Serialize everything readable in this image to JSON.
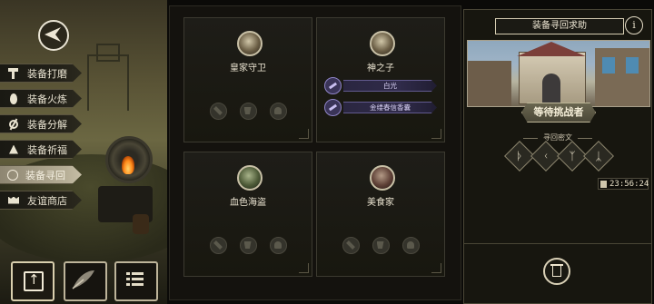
{
  "menu": {
    "items": [
      {
        "label": "装备打磨",
        "icon": "hammer-icon"
      },
      {
        "label": "装备火炼",
        "icon": "flame-icon"
      },
      {
        "label": "装备分解",
        "icon": "split-icon"
      },
      {
        "label": "装备祈福",
        "icon": "pray-icon"
      },
      {
        "label": "装备寻回",
        "icon": "search-icon",
        "active": true
      },
      {
        "label": "友谊商店",
        "icon": "shop-icon"
      }
    ]
  },
  "players": [
    {
      "name": "皇家守卫",
      "avatar": "knight-avatar"
    },
    {
      "name": "神之子",
      "avatar": "helmet-avatar",
      "items": [
        "白光",
        "金缕春信香囊"
      ]
    },
    {
      "name": "血色海盗",
      "avatar": "pirate-avatar"
    },
    {
      "name": "美食家",
      "avatar": "gourmet-avatar"
    }
  ],
  "panel": {
    "title": "装备寻回求助",
    "info": "i",
    "status": "等待挑战者",
    "cipher_label": "寻回密文",
    "runes": [
      "ᚦ",
      "ᚲ",
      "ᛉ",
      "ᛣ"
    ],
    "timer": "23:56:24"
  },
  "colors": {
    "accent": "#d5ccb1",
    "active_menu": "#b6ae96",
    "purple_item": "#625a8f"
  }
}
